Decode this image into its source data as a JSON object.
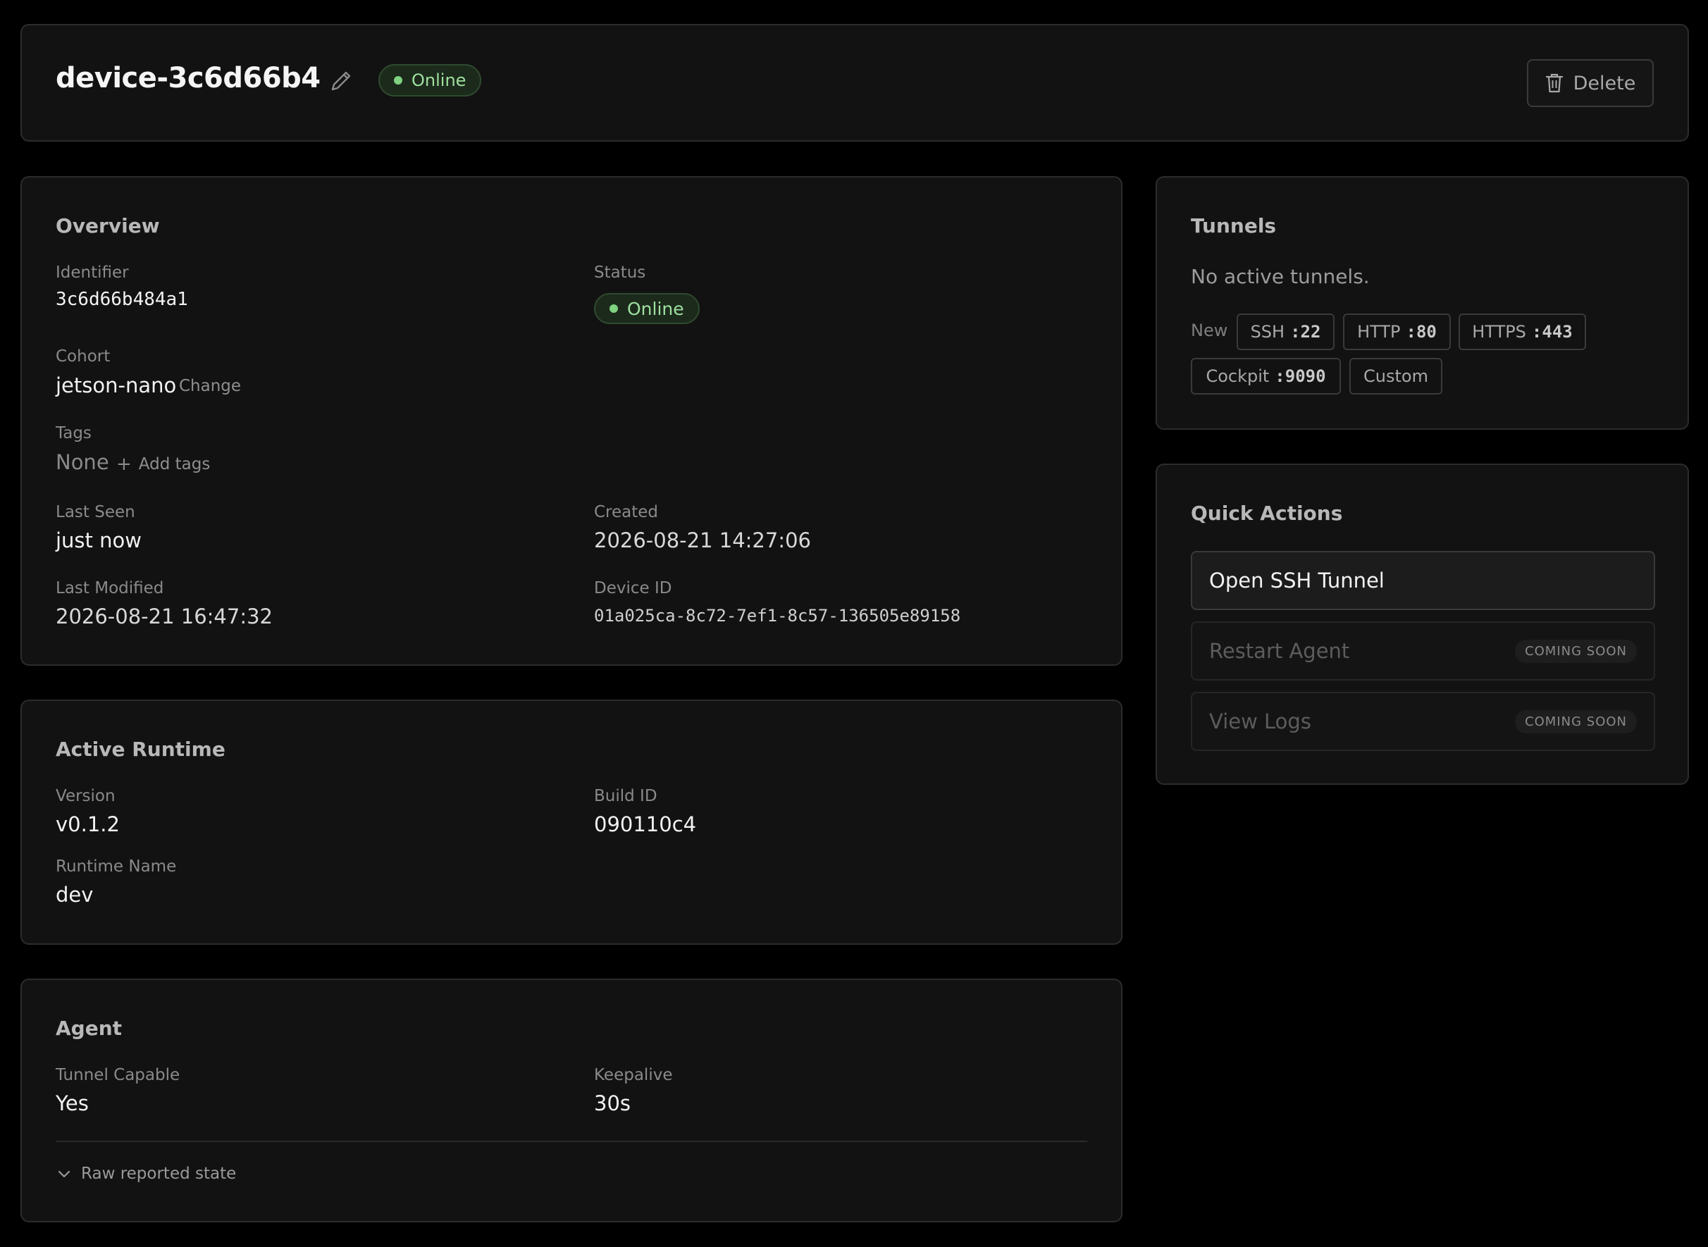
{
  "header": {
    "device_name": "device-3c6d66b4",
    "status": "Online",
    "delete_label": "Delete"
  },
  "overview": {
    "title": "Overview",
    "identifier_label": "Identifier",
    "identifier_value": "3c6d66b484a1",
    "status_label": "Status",
    "status_value": "Online",
    "cohort_label": "Cohort",
    "cohort_value": "jetson-nano",
    "cohort_change": "Change",
    "tags_label": "Tags",
    "tags_value": "None",
    "add_tags": "Add tags",
    "last_seen_label": "Last Seen",
    "last_seen_value": "just now",
    "created_label": "Created",
    "created_value": "2026-08-21 14:27:06",
    "last_modified_label": "Last Modified",
    "last_modified_value": "2026-08-21 16:47:32",
    "device_id_label": "Device ID",
    "device_id_value": "01a025ca-8c72-7ef1-8c57-136505e89158"
  },
  "runtime": {
    "title": "Active Runtime",
    "version_label": "Version",
    "version_value": "v0.1.2",
    "build_label": "Build ID",
    "build_value": "090110c4",
    "name_label": "Runtime Name",
    "name_value": "dev"
  },
  "agent": {
    "title": "Agent",
    "tunnel_label": "Tunnel Capable",
    "tunnel_value": "Yes",
    "keepalive_label": "Keepalive",
    "keepalive_value": "30s",
    "raw_toggle": "Raw reported state"
  },
  "tunnels": {
    "title": "Tunnels",
    "empty_text": "No active tunnels.",
    "new_label": "New",
    "presets": [
      {
        "name": "SSH",
        "port": ":22"
      },
      {
        "name": "HTTP",
        "port": ":80"
      },
      {
        "name": "HTTPS",
        "port": ":443"
      },
      {
        "name": "Cockpit",
        "port": ":9090"
      }
    ],
    "custom_label": "Custom"
  },
  "quick_actions": {
    "title": "Quick Actions",
    "open_ssh": "Open SSH Tunnel",
    "restart_agent": "Restart Agent",
    "view_logs": "View Logs",
    "coming_soon": "COMING SOON"
  },
  "colors": {
    "background": "#000000",
    "card": "#121212",
    "border": "#2c2c2c",
    "online_text": "#9ee09e",
    "online_dot": "#7fd27f"
  }
}
